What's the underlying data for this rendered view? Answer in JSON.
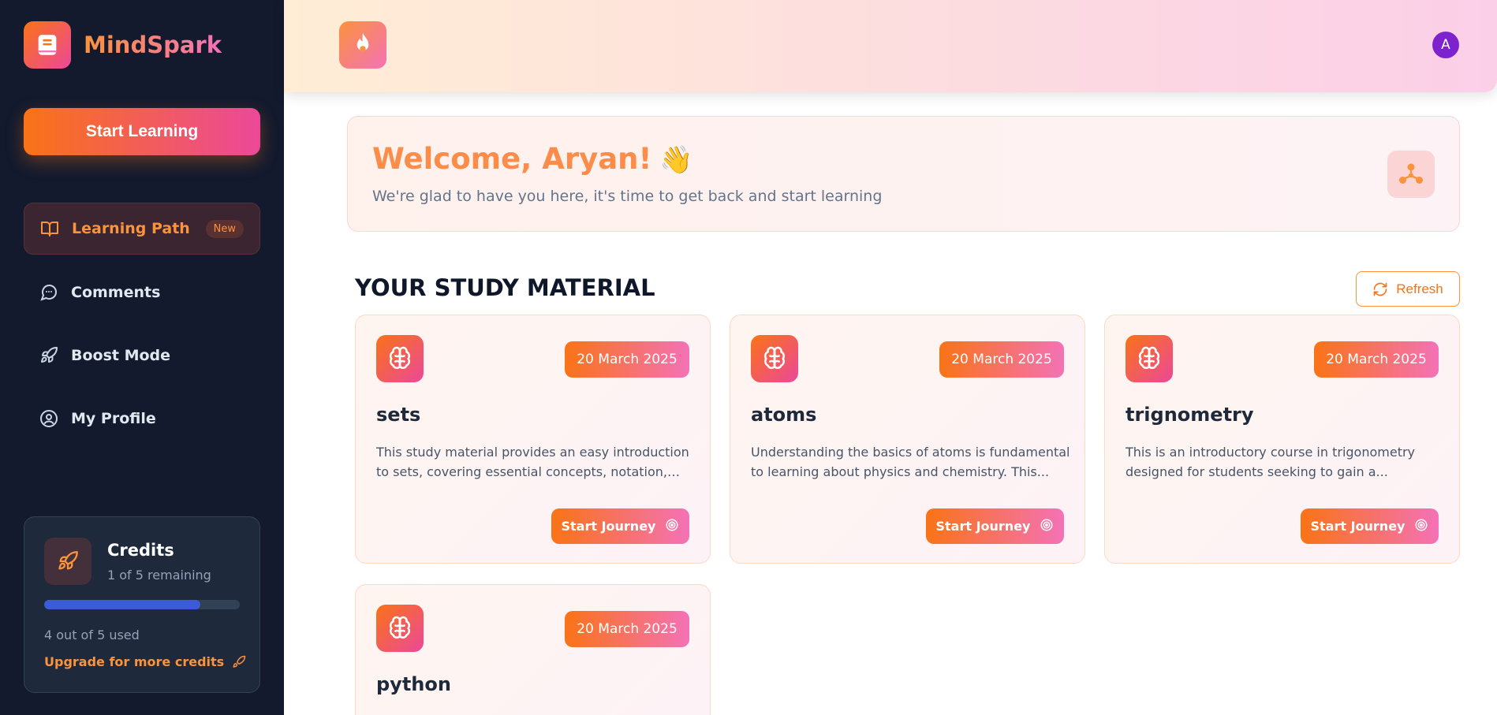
{
  "brand": {
    "name": "MindSpark",
    "logo_icon": "book-icon"
  },
  "sidebar": {
    "start_button": "Start Learning",
    "nav": [
      {
        "label": "Learning Path",
        "icon": "book-open-icon",
        "badge": "New",
        "active": true
      },
      {
        "label": "Comments",
        "icon": "chat-icon"
      },
      {
        "label": "Boost Mode",
        "icon": "rocket-icon"
      },
      {
        "label": "My Profile",
        "icon": "user-circle-icon"
      }
    ],
    "credits": {
      "title": "Credits",
      "remaining": "1 of 5 remaining",
      "used": "4 out of 5 used",
      "used_fraction": 0.8,
      "upgrade": "Upgrade for more credits"
    }
  },
  "header": {
    "icon": "flame-icon",
    "avatar_initial": "A"
  },
  "welcome": {
    "title": "Welcome, Aryan!",
    "emoji": "👋",
    "subtitle": "We're glad to have you here, it's time to get back and start learning"
  },
  "study": {
    "title": "YOUR STUDY MATERIAL",
    "refresh": "Refresh",
    "cards": [
      {
        "date": "20 March 2025",
        "title": "sets",
        "description": "This study material provides an easy introduction to sets, covering essential concepts, notation, and...",
        "button": "Start Journey"
      },
      {
        "date": "20 March 2025",
        "title": "atoms",
        "description": "Understanding the basics of atoms is fundamental to learning about physics and chemistry. This...",
        "button": "Start Journey"
      },
      {
        "date": "20 March 2025",
        "title": "trignometry",
        "description": "This is an introductory course in trigonometry designed for students seeking to gain a...",
        "button": "Start Journey"
      },
      {
        "date": "20 March 2025",
        "title": "python",
        "description": "",
        "button": ""
      }
    ]
  },
  "colors": {
    "accent_orange": "#f97316",
    "accent_pink": "#ec4899",
    "sidebar_bg": "#131a2e",
    "credits_bar": "#3b5bdb"
  }
}
